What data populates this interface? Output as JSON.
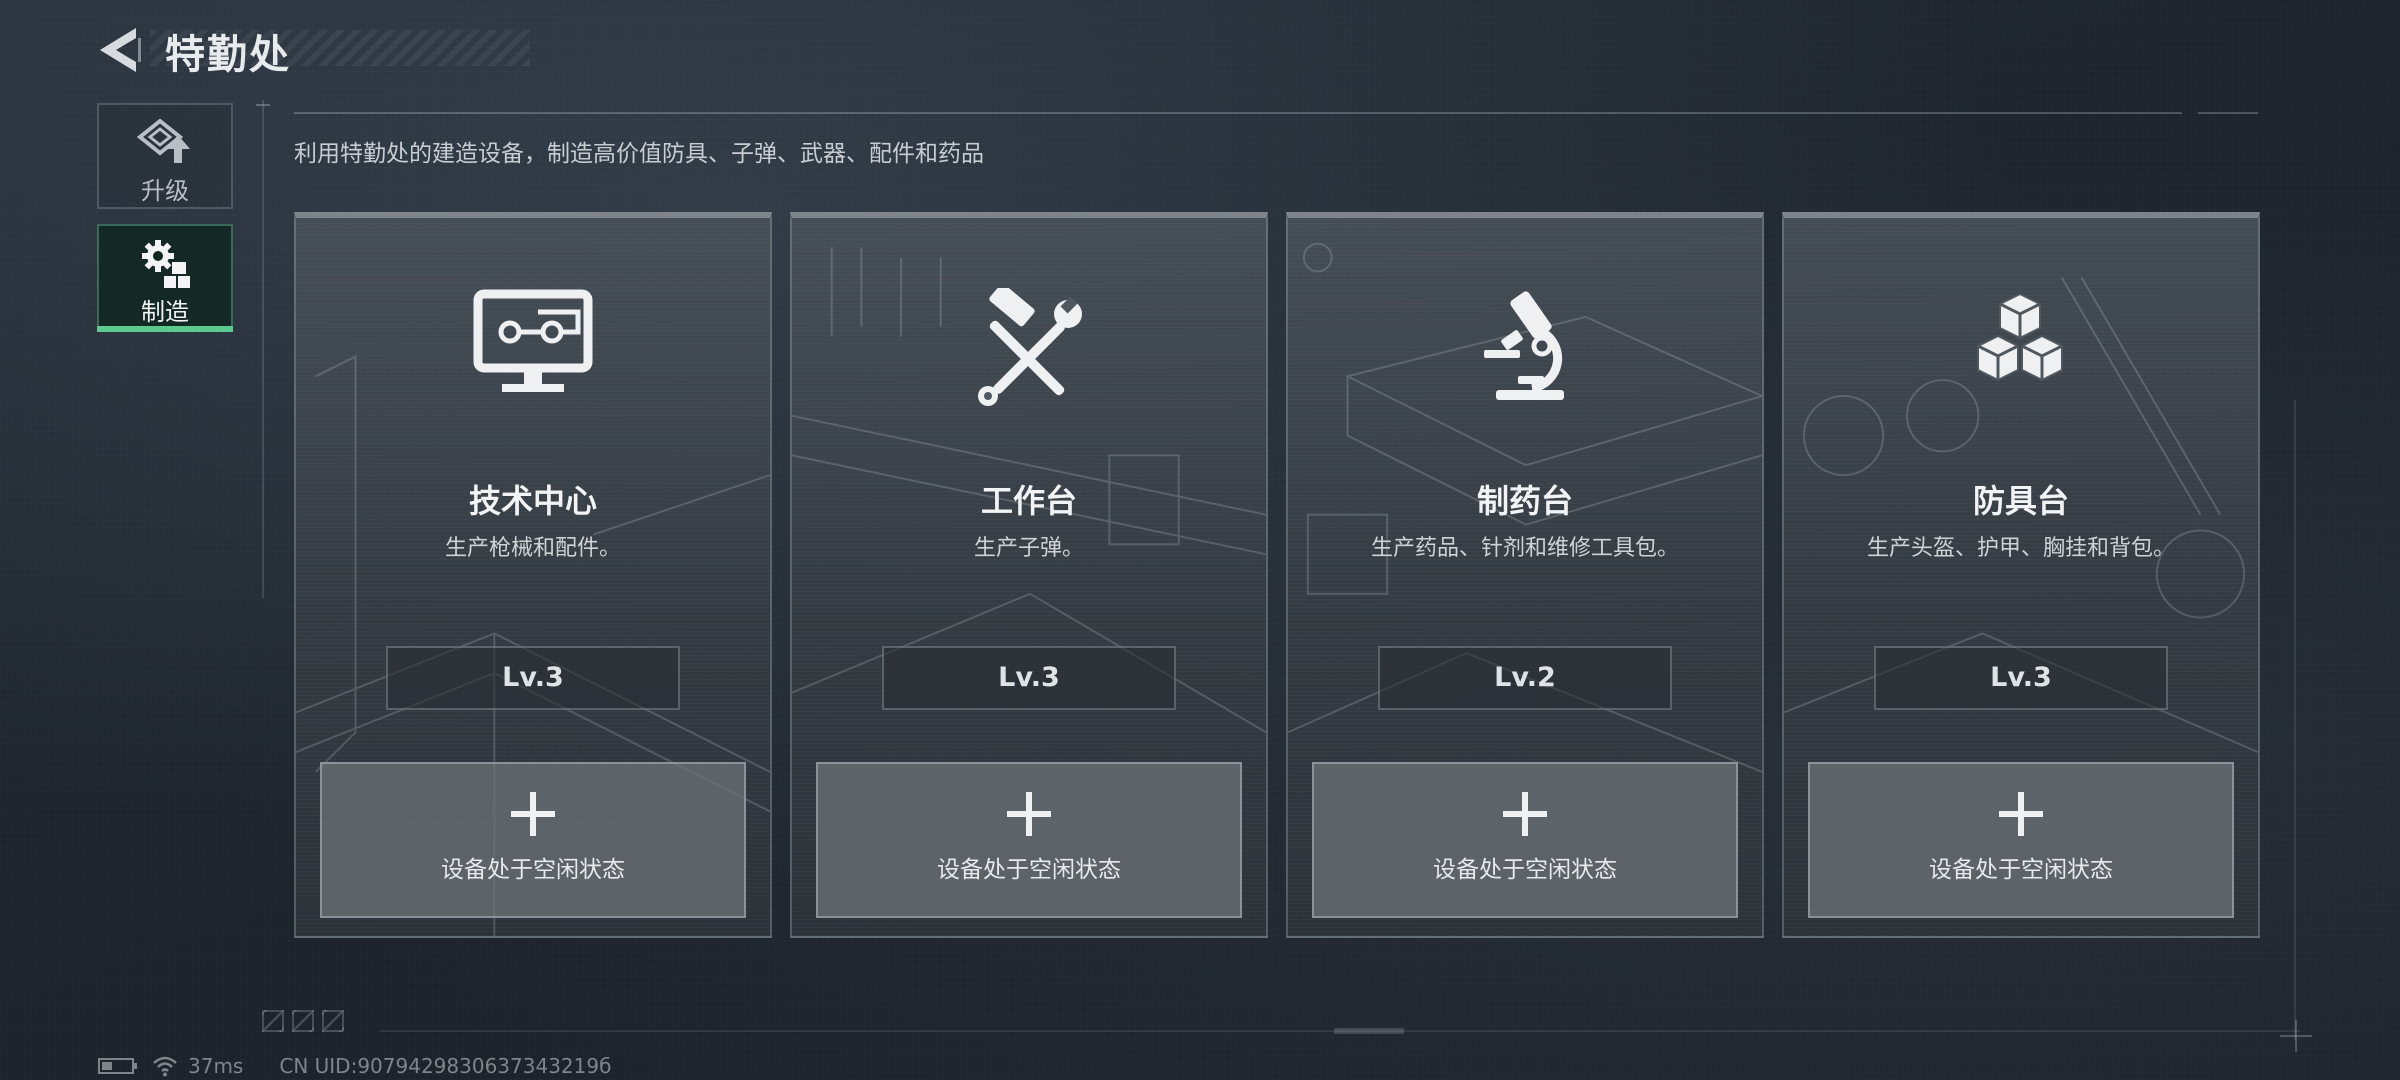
{
  "header": {
    "title": "特勤处"
  },
  "side_tabs": [
    {
      "label": "升级",
      "icon": "upgrade-icon",
      "active": false
    },
    {
      "label": "制造",
      "icon": "gears-cubes-icon",
      "active": true
    }
  ],
  "description": "利用特勤处的建造设备，制造高价值防具、子弹、武器、配件和药品",
  "stations": [
    {
      "name": "技术中心",
      "desc": "生产枪械和配件。",
      "level": "Lv.3",
      "status": "设备处于空闲状态",
      "icon": "computer-monitor-icon"
    },
    {
      "name": "工作台",
      "desc": "生产子弹。",
      "level": "Lv.3",
      "status": "设备处于空闲状态",
      "icon": "hammer-wrench-icon"
    },
    {
      "name": "制药台",
      "desc": "生产药品、针剂和维修工具包。",
      "level": "Lv.2",
      "status": "设备处于空闲状态",
      "icon": "microscope-icon"
    },
    {
      "name": "防具台",
      "desc": "生产头盔、护甲、胸挂和背包。",
      "level": "Lv.3",
      "status": "设备处于空闲状态",
      "icon": "stacked-cubes-icon"
    }
  ],
  "status_bar": {
    "latency": "37ms",
    "uid": "CN UID:9079429830637343219б"
  },
  "colors": {
    "accent_active": "#5cc990",
    "background": "#1c232b"
  }
}
